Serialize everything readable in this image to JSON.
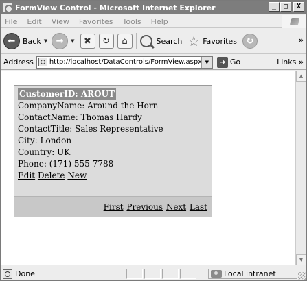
{
  "window": {
    "title": "FormView Control - Microsoft Internet Explorer",
    "minimize_glyph": "_",
    "maximize_glyph": "□",
    "close_glyph": "X"
  },
  "menu": [
    "File",
    "Edit",
    "View",
    "Favorites",
    "Tools",
    "Help"
  ],
  "toolbar": {
    "back_label": "Back",
    "search_label": "Search",
    "favorites_label": "Favorites",
    "more_glyph": "»"
  },
  "address": {
    "label": "Address",
    "url": "http://localhost/DataControls/FormView.aspx",
    "go_label": "Go",
    "links_label": "Links",
    "links_more": "»"
  },
  "formview": {
    "header": "CustomerID: AROUT",
    "fields": [
      {
        "label": "CompanyName:",
        "value": "Around the Horn"
      },
      {
        "label": "ContactName:",
        "value": "Thomas Hardy"
      },
      {
        "label": "ContactTitle:",
        "value": "Sales Representative"
      },
      {
        "label": "City:",
        "value": "London"
      },
      {
        "label": "Country:",
        "value": "UK"
      },
      {
        "label": "Phone:",
        "value": "(171) 555-7788"
      }
    ],
    "actions": {
      "edit": "Edit",
      "delete": "Delete",
      "new": "New"
    },
    "pager": {
      "first": "First",
      "previous": "Previous",
      "next": "Next",
      "last": "Last"
    }
  },
  "status": {
    "text": "Done",
    "zone": "Local intranet"
  },
  "colors": {
    "formview_bg": "#dcdcdc",
    "header_bg": "#8a8a8a",
    "pager_bg": "#c8c8c8"
  }
}
